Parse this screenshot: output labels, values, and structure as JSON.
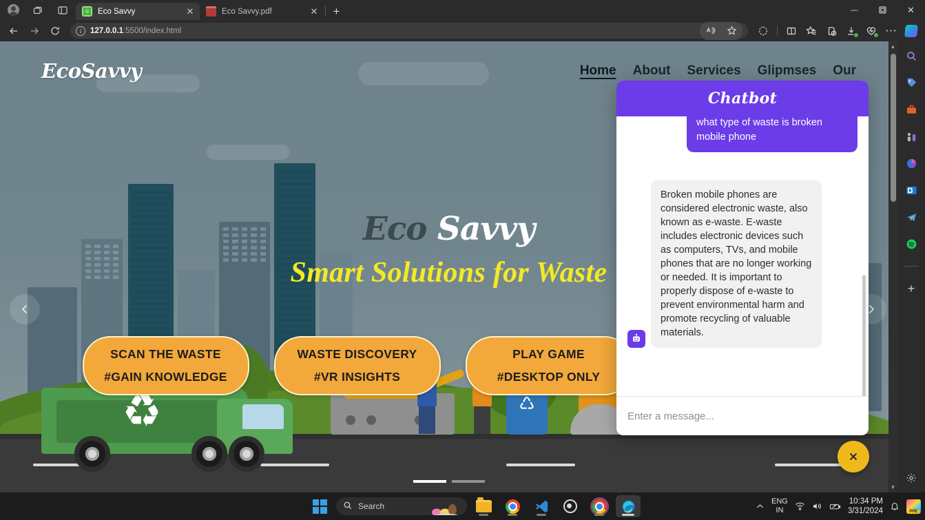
{
  "browser": {
    "tabs": [
      {
        "title": "Eco Savvy",
        "favicon": "eco-leaf-icon",
        "active": true
      },
      {
        "title": "Eco Savvy.pdf",
        "favicon": "pdf-file-icon",
        "active": false
      }
    ],
    "new_tab_label": "+",
    "window_controls": {
      "minimize": "—",
      "maximize": "❐",
      "close": "✕"
    },
    "titlebar_icons": [
      "profile-avatar-icon",
      "workspaces-icon",
      "tab-actions-icon"
    ],
    "address_bar": {
      "info_icon": "i",
      "url_host": "127.0.0.1",
      "url_path": ":5500/index.html",
      "full_url": "127.0.0.1:5500/index.html"
    },
    "nav_icons": [
      "back-icon",
      "forward-icon",
      "refresh-icon"
    ],
    "toolbar_icons": [
      "read-aloud-icon",
      "favorite-star-icon",
      "copilot-shopping-icon",
      "split-screen-icon",
      "favorites-icon",
      "collections-icon",
      "downloads-icon",
      "browser-essentials-icon",
      "more-options-icon",
      "copilot-icon"
    ],
    "sidebar_icons": [
      "search-icon",
      "shopping-tag-icon",
      "tools-briefcase-icon",
      "games-icon",
      "microsoft-365-icon",
      "outlook-icon",
      "telegram-icon",
      "spotify-icon",
      "add-sidebar-app-icon",
      "settings-gear-icon"
    ]
  },
  "page": {
    "brand": "EcoSavvy",
    "nav_links": [
      {
        "label": "Home",
        "active": true
      },
      {
        "label": "About",
        "active": false
      },
      {
        "label": "Services",
        "active": false
      },
      {
        "label": "Glipmses",
        "active": false
      },
      {
        "label": "Our",
        "active": false
      }
    ],
    "hero": {
      "title_part1": "Eco",
      "title_part2": "Savvy",
      "subtitle": "Smart Solutions for Waste"
    },
    "cta_buttons": [
      {
        "title": "SCAN THE WASTE",
        "subtitle": "#GAIN KNOWLEDGE"
      },
      {
        "title": "WASTE DISCOVERY",
        "subtitle": "#VR INSIGHTS"
      },
      {
        "title": "PLAY GAME",
        "subtitle": "#DESKTOP ONLY"
      }
    ],
    "carousel": {
      "prev_icon": "chevron-left-icon",
      "next_icon": "chevron-right-icon",
      "slide_count": 2,
      "active_slide": 1
    },
    "colors": {
      "cta_background": "#f2a83a",
      "subtitle_yellow": "#f3e926",
      "sky": "#6f838c",
      "grass": "#5b8a2a"
    }
  },
  "chatbot": {
    "title": "Chatbot",
    "header_color": "#6b3ce8",
    "messages": [
      {
        "role": "user",
        "text": "what type of waste is broken mobile phone"
      },
      {
        "role": "bot",
        "avatar": "robot-icon",
        "text": "Broken mobile phones are considered electronic waste, also known as e-waste. E-waste includes electronic devices such as computers, TVs, and mobile phones that are no longer working or needed. It is important to properly dispose of e-waste to prevent environmental harm and promote recycling of valuable materials."
      }
    ],
    "input_placeholder": "Enter a message...",
    "close_icon": "close-icon",
    "close_button_color": "#f0b91b"
  },
  "taskbar": {
    "start_icon": "windows-start-icon",
    "search_placeholder": "Search",
    "apps": [
      {
        "name": "file-explorer",
        "active": false
      },
      {
        "name": "google-chrome",
        "active": false
      },
      {
        "name": "visual-studio-code",
        "active": false
      },
      {
        "name": "obs-studio",
        "active": false
      },
      {
        "name": "google-chrome-2",
        "active": false
      },
      {
        "name": "microsoft-edge",
        "active": true
      }
    ],
    "tray": {
      "chevron_icon": "chevron-up-icon",
      "language_line1": "ENG",
      "language_line2": "IN",
      "wifi_icon": "wifi-icon",
      "volume_icon": "volume-icon",
      "battery_icon": "battery-icon",
      "time": "10:34 PM",
      "date": "3/31/2024",
      "notification_icon": "bell-icon",
      "app_icon": "pre-app-icon"
    }
  }
}
